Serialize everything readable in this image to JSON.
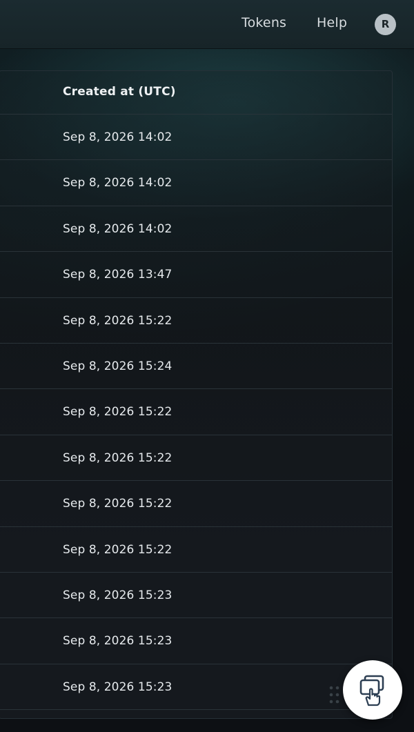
{
  "header": {
    "nav": [
      {
        "label": "Tokens"
      },
      {
        "label": "Help"
      }
    ],
    "avatar_initial": "R"
  },
  "table": {
    "columns": [
      "Created at (UTC)"
    ],
    "rows": [
      "Sep 8, 2026 14:02",
      "Sep 8, 2026 14:02",
      "Sep 8, 2026 14:02",
      "Sep 8, 2026 13:47",
      "Sep 8, 2026 15:22",
      "Sep 8, 2026 15:24",
      "Sep 8, 2026 15:22",
      "Sep 8, 2026 15:22",
      "Sep 8, 2026 15:22",
      "Sep 8, 2026 15:22",
      "Sep 8, 2026 15:23",
      "Sep 8, 2026 15:23",
      "Sep 8, 2026 15:23"
    ]
  },
  "widget": {
    "icon": "windows-pointer-icon",
    "handle_icon": "drag-handle-icon"
  },
  "colors": {
    "header_bg": "#1b2b30",
    "page_bg": "#0d1014",
    "text": "#e6eaed",
    "avatar_bg": "#b9c1c6"
  }
}
